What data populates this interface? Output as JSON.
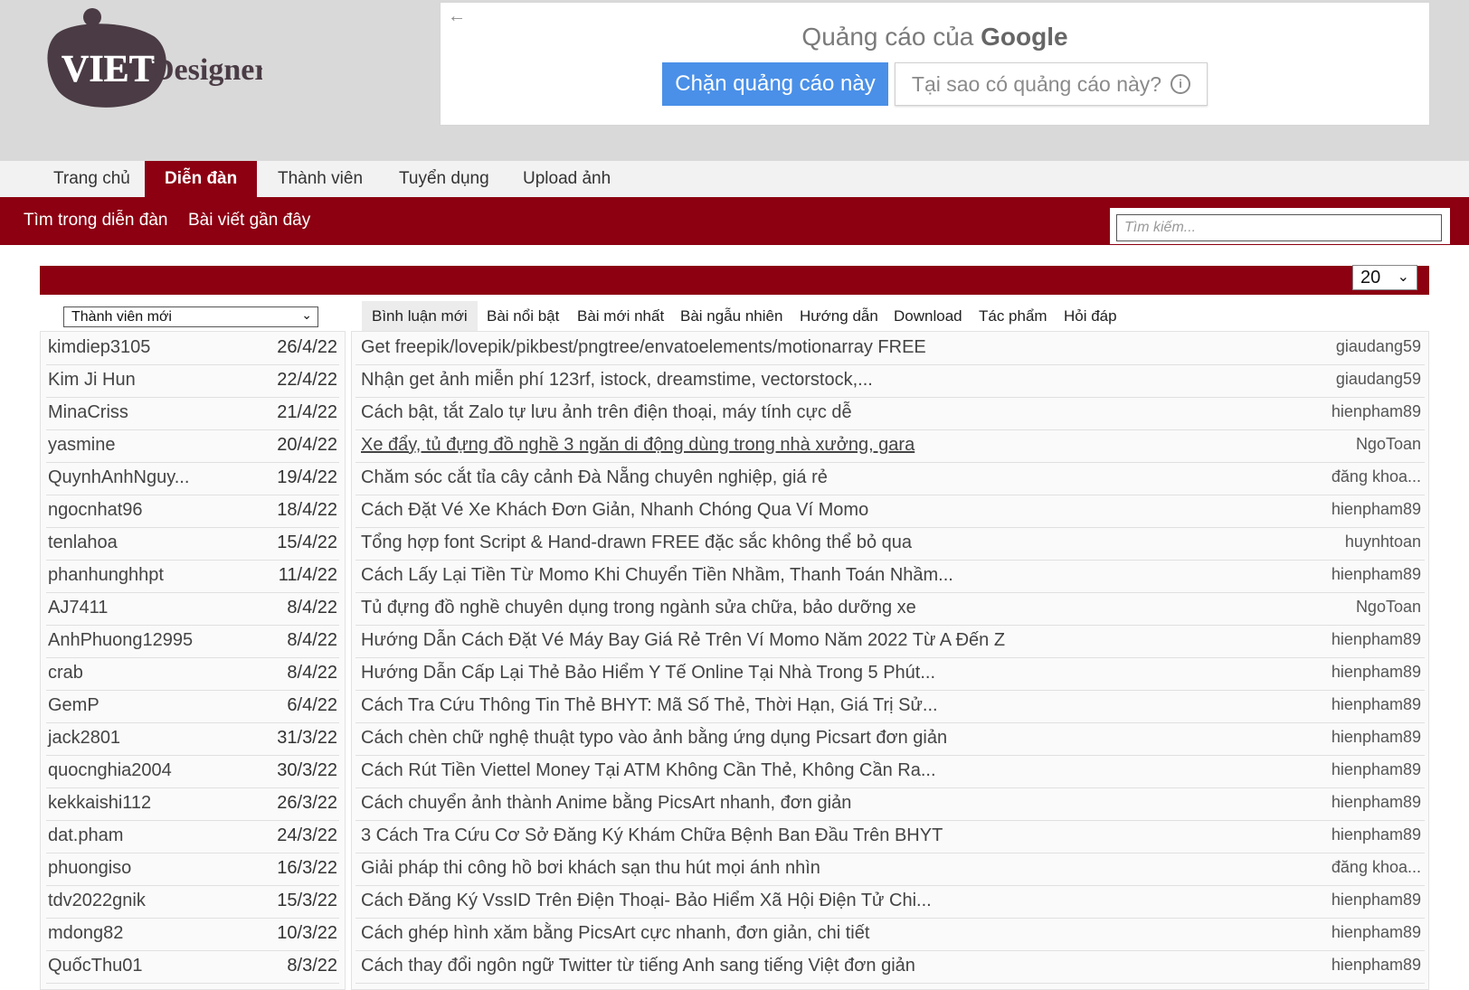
{
  "brand": {
    "logo_word1": "VIET",
    "logo_word2": "Designer"
  },
  "ad": {
    "back_icon": "←",
    "title_prefix": "Quảng cáo của",
    "title_brand": "Google",
    "block_button": "Chặn quảng cáo này",
    "why_button": "Tại sao có quảng cáo này?",
    "info_icon": "i"
  },
  "nav": {
    "tabs": [
      {
        "label": "Trang chủ"
      },
      {
        "label": "Diễn đàn"
      },
      {
        "label": "Thành viên"
      },
      {
        "label": "Tuyển dụng"
      },
      {
        "label": "Upload ảnh"
      }
    ],
    "active_index": 1
  },
  "subnav": {
    "links": [
      {
        "label": "Tìm trong diễn đàn"
      },
      {
        "label": "Bài viết gần đây"
      }
    ],
    "search_placeholder": "Tìm kiếm..."
  },
  "per_page": {
    "value": "20",
    "chevron": "⌄"
  },
  "members": {
    "select_value": "Thành viên mới",
    "chevron": "⌄",
    "rows": [
      {
        "name": "kimdiep3105",
        "date": "26/4/22"
      },
      {
        "name": "Kim Ji Hun",
        "date": "22/4/22"
      },
      {
        "name": "MinaCriss",
        "date": "21/4/22"
      },
      {
        "name": "yasmine",
        "date": "20/4/22"
      },
      {
        "name": "QuynhAnhNguy...",
        "date": "19/4/22"
      },
      {
        "name": "ngocnhat96",
        "date": "18/4/22"
      },
      {
        "name": "tenlahoa",
        "date": "15/4/22"
      },
      {
        "name": "phanhunghhpt",
        "date": "11/4/22"
      },
      {
        "name": "AJ7411",
        "date": "8/4/22"
      },
      {
        "name": "AnhPhuong12995",
        "date": "8/4/22"
      },
      {
        "name": "crab",
        "date": "8/4/22"
      },
      {
        "name": "GemP",
        "date": "6/4/22"
      },
      {
        "name": "jack2801",
        "date": "31/3/22"
      },
      {
        "name": "quocnghia2004",
        "date": "30/3/22"
      },
      {
        "name": "kekkaishi112",
        "date": "26/3/22"
      },
      {
        "name": "dat.pham",
        "date": "24/3/22"
      },
      {
        "name": "phuongiso",
        "date": "16/3/22"
      },
      {
        "name": "tdv2022gnik",
        "date": "15/3/22"
      },
      {
        "name": "mdong82",
        "date": "10/3/22"
      },
      {
        "name": "QuốcThu01",
        "date": "8/3/22"
      }
    ]
  },
  "tabs": {
    "items": [
      {
        "label": "Bình luận mới"
      },
      {
        "label": "Bài nổi bật"
      },
      {
        "label": "Bài mới nhất"
      },
      {
        "label": "Bài ngẫu nhiên"
      },
      {
        "label": "Hướng dẫn"
      },
      {
        "label": "Download"
      },
      {
        "label": "Tác phẩm"
      },
      {
        "label": "Hỏi đáp"
      }
    ],
    "active_index": 0
  },
  "threads": [
    {
      "title": "Get freepik/lovepik/pikbest/pngtree/envatoelements/motionarray FREE",
      "author": "giaudang59"
    },
    {
      "title": "Nhận get ảnh miễn phí 123rf, istock, dreamstime, vectorstock,...",
      "author": "giaudang59"
    },
    {
      "title": "Cách bật, tắt Zalo tự lưu ảnh trên điện thoại, máy tính cực dễ",
      "author": "hienpham89"
    },
    {
      "title": "Xe đẩy, tủ đựng đồ nghề 3 ngăn di động dùng trong nhà xưởng, gara",
      "author": "NgoToan"
    },
    {
      "title": "Chăm sóc cắt tỉa cây cảnh Đà Nẵng chuyên nghiệp, giá rẻ",
      "author": "đăng khoa..."
    },
    {
      "title": "Cách Đặt Vé Xe Khách Đơn Giản, Nhanh Chóng Qua Ví Momo",
      "author": "hienpham89"
    },
    {
      "title": "Tổng hợp font Script & Hand-drawn FREE đặc sắc không thể bỏ qua",
      "author": "huynhtoan"
    },
    {
      "title": "Cách Lấy Lại Tiền Từ Momo Khi Chuyển Tiền Nhầm, Thanh Toán Nhầm...",
      "author": "hienpham89"
    },
    {
      "title": "Tủ đựng đồ nghề chuyên dụng trong ngành sửa chữa, bảo dưỡng xe",
      "author": "NgoToan"
    },
    {
      "title": "Hướng Dẫn Cách Đặt Vé Máy Bay Giá Rẻ Trên Ví Momo Năm 2022 Từ A Đến Z",
      "author": "hienpham89"
    },
    {
      "title": "Hướng Dẫn Cấp Lại Thẻ Bảo Hiểm Y Tế Online Tại Nhà Trong 5 Phút...",
      "author": "hienpham89"
    },
    {
      "title": "Cách Tra Cứu Thông Tin Thẻ BHYT: Mã Số Thẻ, Thời Hạn, Giá Trị Sử...",
      "author": "hienpham89"
    },
    {
      "title": "Cách chèn chữ nghệ thuật typo vào ảnh bằng ứng dụng Picsart đơn giản",
      "author": "hienpham89"
    },
    {
      "title": "Cách Rút Tiền Viettel Money Tại ATM Không Cần Thẻ, Không Cần Ra...",
      "author": "hienpham89"
    },
    {
      "title": "Cách chuyển ảnh thành Anime bằng PicsArt nhanh, đơn giản",
      "author": "hienpham89"
    },
    {
      "title": "3 Cách Tra Cứu Cơ Sở Đăng Ký Khám Chữa Bệnh Ban Đầu Trên BHYT",
      "author": "hienpham89"
    },
    {
      "title": "Giải pháp thi công hồ bơi khách sạn thu hút mọi ánh nhìn",
      "author": "đăng khoa..."
    },
    {
      "title": "Cách Đăng Ký VssID Trên Điện Thoại- Bảo Hiểm Xã Hội Điện Tử Chi...",
      "author": "hienpham89"
    },
    {
      "title": "Cách ghép hình xăm bằng PicsArt cực nhanh, đơn giản, chi tiết",
      "author": "hienpham89"
    },
    {
      "title": "Cách thay đổi ngôn ngữ Twitter từ tiếng Anh sang tiếng Việt đơn giản",
      "author": "hienpham89"
    }
  ],
  "colors": {
    "brand_red": "#8c0012",
    "ad_blue": "#4a90e8",
    "header_gray": "#d9d9d9"
  }
}
